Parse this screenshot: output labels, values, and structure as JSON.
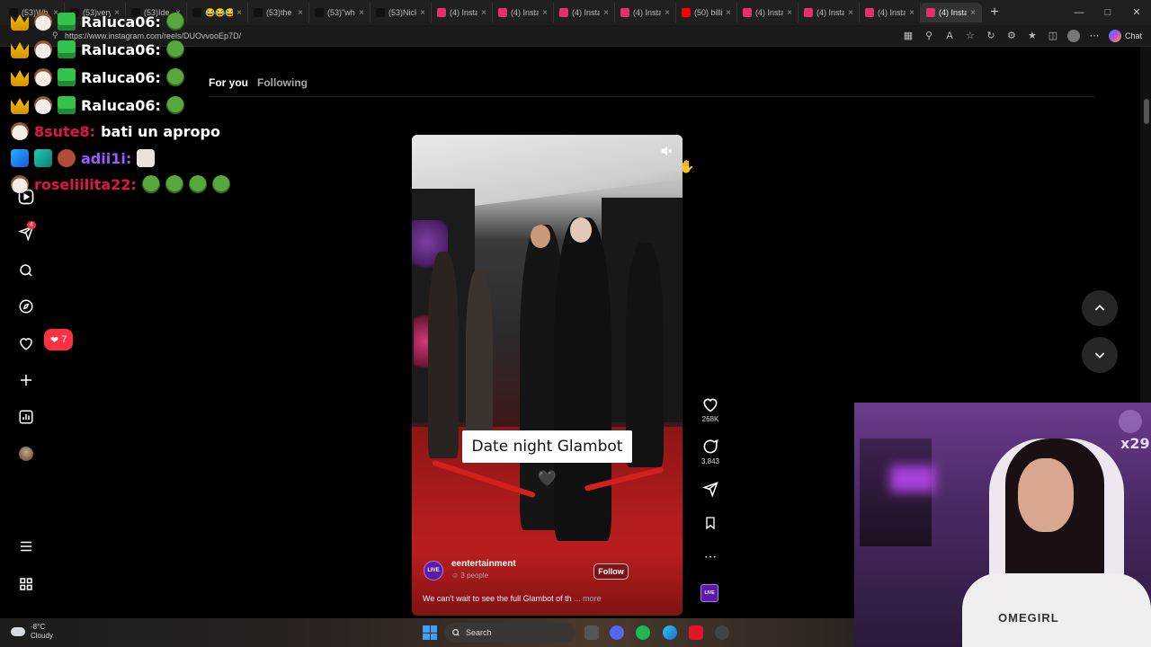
{
  "browser": {
    "tabs": [
      {
        "title": "(53)Wh",
        "fav": "tiktok-icon",
        "color": "#111111"
      },
      {
        "title": "(53)very",
        "fav": "tiktok-icon",
        "color": "#111111"
      },
      {
        "title": "(53)Ide",
        "fav": "tiktok-icon",
        "color": "#111111"
      },
      {
        "title": "😂😂😂",
        "fav": "tiktok-icon",
        "color": "#111111"
      },
      {
        "title": "(53)the c",
        "fav": "tiktok-icon",
        "color": "#111111"
      },
      {
        "title": "(53)\"whe",
        "fav": "tiktok-icon",
        "color": "#111111"
      },
      {
        "title": "(53)Nick",
        "fav": "tiktok-icon",
        "color": "#111111"
      },
      {
        "title": "(4) Insta",
        "fav": "instagram-icon",
        "color": "#e1306c"
      },
      {
        "title": "(4) Insta",
        "fav": "instagram-icon",
        "color": "#e1306c"
      },
      {
        "title": "(4) Insta",
        "fav": "instagram-icon",
        "color": "#e1306c"
      },
      {
        "title": "(4) Insta",
        "fav": "instagram-icon",
        "color": "#e1306c"
      },
      {
        "title": "(50) billi",
        "fav": "youtube-icon",
        "color": "#ff0000"
      },
      {
        "title": "(4) Insta",
        "fav": "instagram-icon",
        "color": "#e1306c"
      },
      {
        "title": "(4) Insta",
        "fav": "instagram-icon",
        "color": "#e1306c"
      },
      {
        "title": "(4) Insta",
        "fav": "instagram-icon",
        "color": "#e1306c"
      },
      {
        "title": "(4) Insta",
        "fav": "instagram-icon",
        "color": "#e1306c",
        "active": true
      }
    ],
    "url": "https://www.instagram.com/reels/DUOvvooEp7D/",
    "chat_label": "Chat"
  },
  "feed_tabs": {
    "for_you": "For you",
    "following": "Following"
  },
  "sidebar": {
    "messages_badge": "4",
    "notifications_count": "7"
  },
  "reel": {
    "overlay_caption": "Date night Glambot 🖤",
    "account_handle": "eentertainment",
    "account_avatar_text": "LIVE",
    "audience": "3 people",
    "follow_label": "Follow",
    "description": "We can't wait to see the full Glambot of th",
    "more_label": "... more",
    "likes": "268K",
    "comments": "3,843"
  },
  "chat_overlay": {
    "messages": [
      {
        "user": "Raluca06:",
        "color": "#ffffff",
        "text": ""
      },
      {
        "user": "Raluca06:",
        "color": "#ffffff",
        "text": ""
      },
      {
        "user": "Raluca06:",
        "color": "#ffffff",
        "text": ""
      },
      {
        "user": "Raluca06:",
        "color": "#ffffff",
        "text": ""
      },
      {
        "user": "8sute8:",
        "color": "#e0144c",
        "text": "bati un apropo"
      },
      {
        "user": "adii1i:",
        "color": "#9b59ff",
        "text": ""
      },
      {
        "user": "roseliilita22:",
        "color": "#e0144c",
        "text": ""
      }
    ]
  },
  "webcam": {
    "badge": "x29",
    "shirt_text": "OMEGIRL"
  },
  "taskbar": {
    "temperature": "-8°C",
    "condition": "Cloudy",
    "search_placeholder": "Search"
  }
}
